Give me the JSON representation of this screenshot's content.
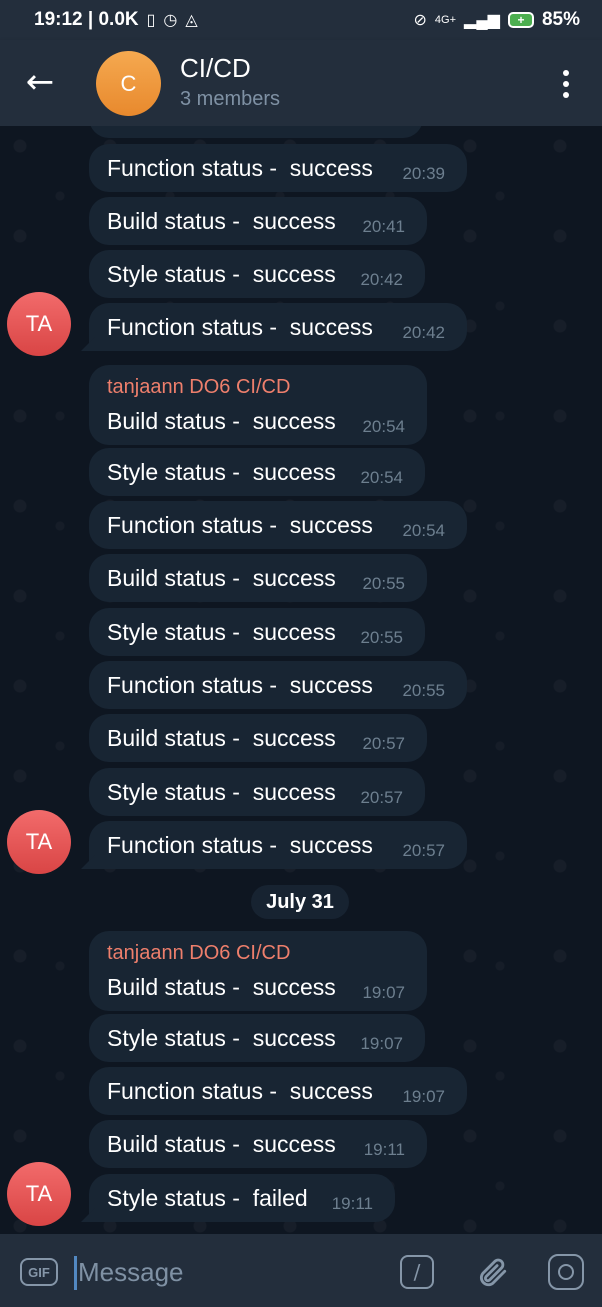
{
  "status_bar": {
    "time_data": "19:12 | 0.0K",
    "network": "4G+",
    "battery": "85%"
  },
  "header": {
    "avatar_letter": "C",
    "title": "CI/CD",
    "subtitle": "3 members"
  },
  "messages": [
    {
      "sender": "",
      "text": "Function status -  success",
      "time": "20:39"
    },
    {
      "sender": "",
      "text": "Build status -  success",
      "time": "20:41"
    },
    {
      "sender": "",
      "text": "Style status -  success",
      "time": "20:42"
    },
    {
      "sender": "",
      "text": "Function status -  success",
      "time": "20:42"
    },
    {
      "sender": "tanjaann DO6 CI/CD",
      "text": "Build status -  success",
      "time": "20:54"
    },
    {
      "sender": "",
      "text": "Style status -  success",
      "time": "20:54"
    },
    {
      "sender": "",
      "text": "Function status -  success",
      "time": "20:54"
    },
    {
      "sender": "",
      "text": "Build status -  success",
      "time": "20:55"
    },
    {
      "sender": "",
      "text": "Style status -  success",
      "time": "20:55"
    },
    {
      "sender": "",
      "text": "Function status -  success",
      "time": "20:55"
    },
    {
      "sender": "",
      "text": "Build status -  success",
      "time": "20:57"
    },
    {
      "sender": "",
      "text": "Style status -  success",
      "time": "20:57"
    },
    {
      "sender": "",
      "text": "Function status -  success",
      "time": "20:57"
    },
    {
      "sender": "tanjaann DO6 CI/CD",
      "text": "Build status -  success",
      "time": "19:07"
    },
    {
      "sender": "",
      "text": "Style status -  success",
      "time": "19:07"
    },
    {
      "sender": "",
      "text": "Function status -  success",
      "time": "19:07"
    },
    {
      "sender": "",
      "text": "Build status -  success",
      "time": "19:11"
    },
    {
      "sender": "",
      "text": "Style status -  failed",
      "time": "19:11"
    }
  ],
  "user_avatar_initials": "TA",
  "date_separator": "July 31",
  "input": {
    "gif_label": "GIF",
    "placeholder": "Message",
    "command_label": "/"
  },
  "colors": {
    "header_bg": "#232e3c",
    "chat_bg": "#0e1621",
    "bubble_bg": "#182533",
    "sender_name": "#ee7f6c",
    "avatar_group": "#f0a04b",
    "avatar_user": "#e55a5a"
  },
  "icons": {
    "back": "arrow-left-icon",
    "menu": "more-vertical-icon",
    "attach": "paperclip-icon",
    "camera": "camera-icon"
  }
}
